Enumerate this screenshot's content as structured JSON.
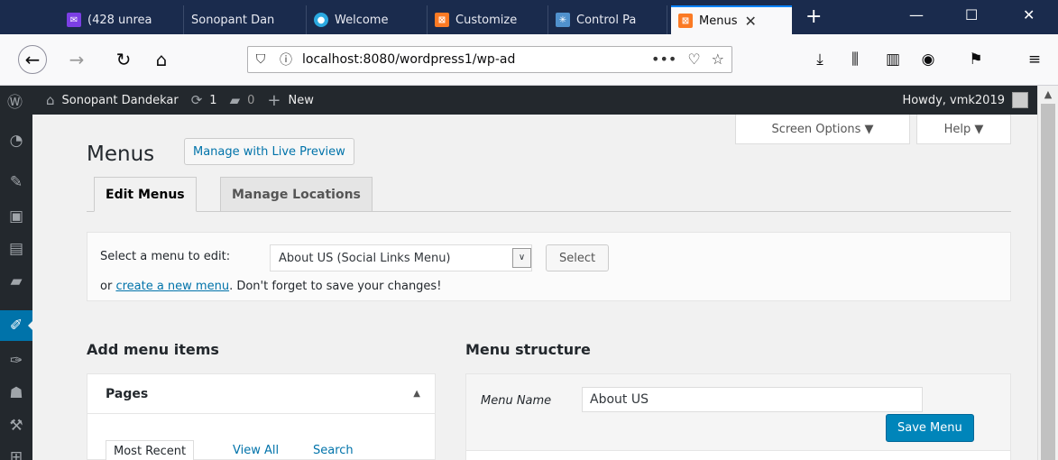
{
  "browser": {
    "tabs": [
      {
        "label": "(428 unrea",
        "favicon": "mail-icon",
        "color": "#7b3fe4"
      },
      {
        "label": "Sonopant Dan",
        "favicon": "",
        "color": ""
      },
      {
        "label": "Welcome",
        "favicon": "drupal-icon",
        "color": "#2ba9e0"
      },
      {
        "label": "Customize",
        "favicon": "xampp-icon",
        "color": "#fb7a24"
      },
      {
        "label": "Control Pa",
        "favicon": "joomla-icon",
        "color": "#5091cd"
      },
      {
        "label": "Menus",
        "favicon": "xampp-icon",
        "color": "#fb7a24",
        "active": true
      }
    ],
    "url": "localhost:8080/wordpress1/wp-ad",
    "url_dots": "•••",
    "close_glyph": "✕"
  },
  "adminbar": {
    "site_name": "Sonopant Dandekar",
    "updates_count": "1",
    "comments_count": "0",
    "new_label": "New",
    "howdy": "Howdy, vmk2019"
  },
  "screen_options": "Screen Options ▼",
  "help": "Help ▼",
  "page": {
    "title": "Menus",
    "live_preview_btn": "Manage with Live Preview",
    "tabs": [
      "Edit Menus",
      "Manage Locations"
    ]
  },
  "select_menu": {
    "label": "Select a menu to edit:",
    "selected": "About US (Social Links Menu)",
    "select_btn": "Select",
    "hint_prefix": "or ",
    "hint_link": "create a new menu",
    "hint_suffix": ". Don't forget to save your changes!"
  },
  "add_items": {
    "heading": "Add menu items",
    "pages_title": "Pages",
    "tabs": [
      "Most Recent",
      "View All",
      "Search"
    ]
  },
  "structure": {
    "heading": "Menu structure",
    "menu_name_label": "Menu Name",
    "menu_name_value": "About US",
    "save_btn": "Save Menu"
  }
}
